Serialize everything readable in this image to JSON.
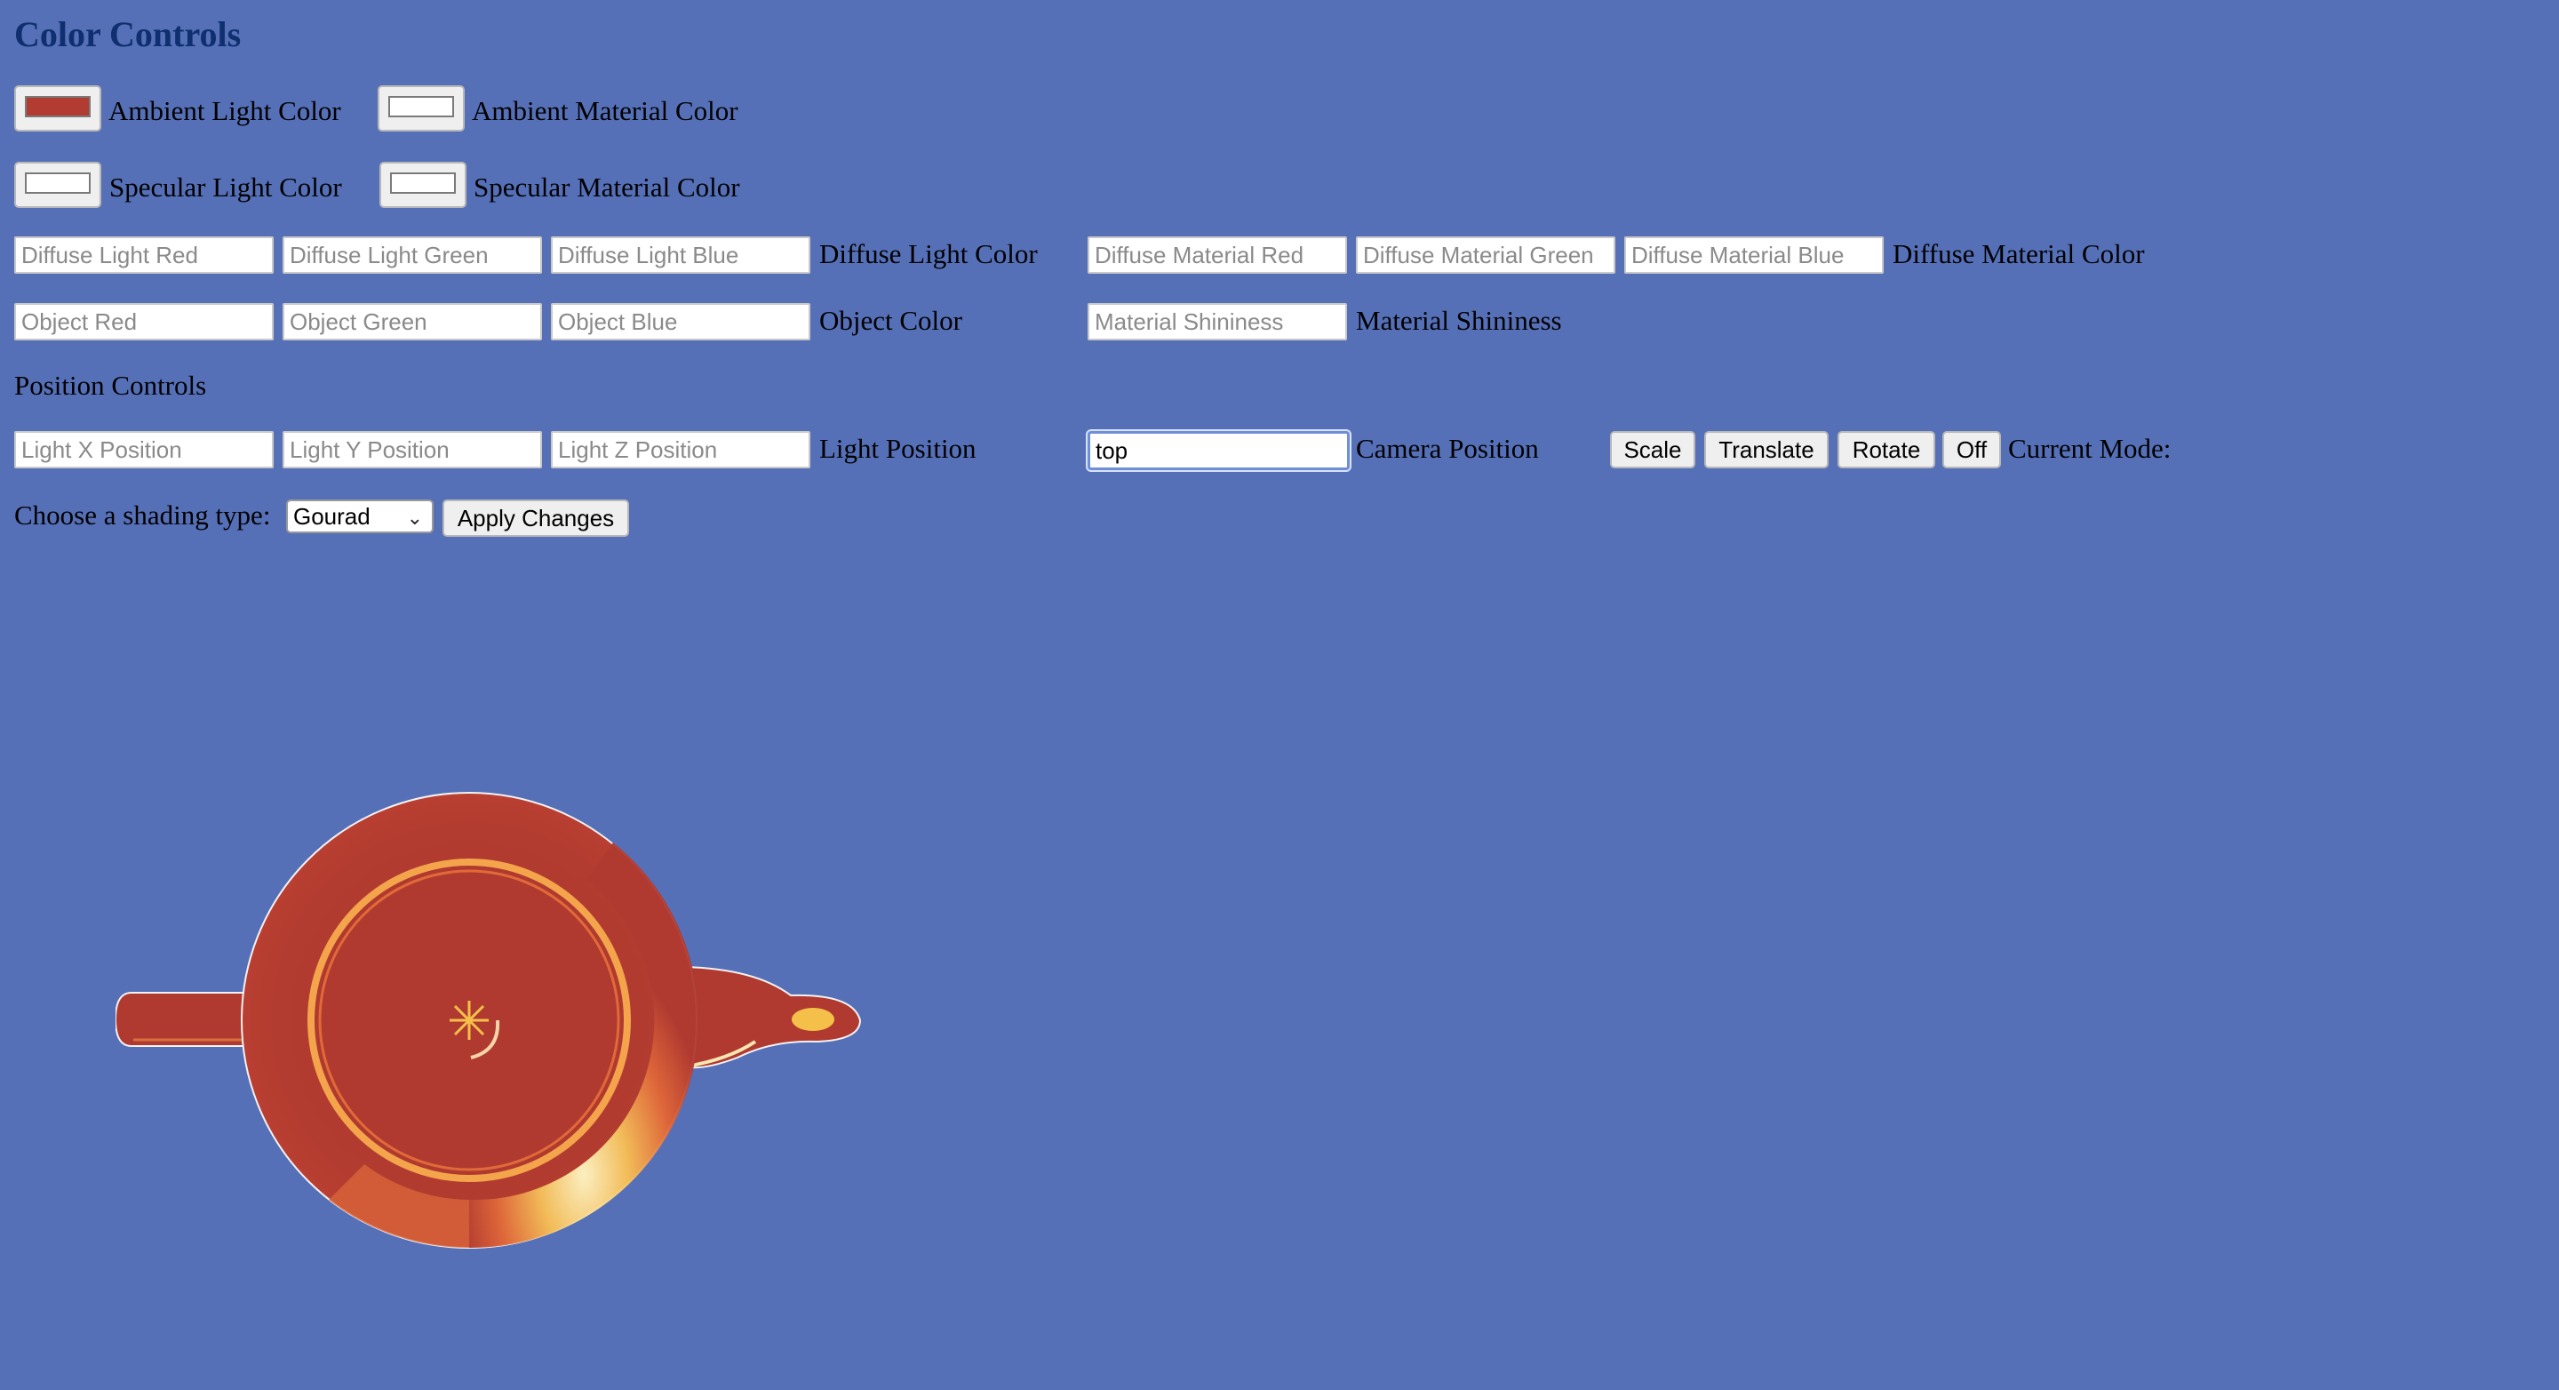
{
  "headings": {
    "color_controls": "Color Controls",
    "position_controls": "Position Controls"
  },
  "ambient": {
    "light_label": "Ambient Light Color",
    "material_label": "Ambient Material Color",
    "light_color": "#b23b32",
    "material_color": "#ffffff"
  },
  "specular": {
    "light_label": "Specular Light Color",
    "material_label": "Specular Material Color",
    "light_color": "#ffffff",
    "material_color": "#ffffff"
  },
  "diffuse_light": {
    "red_placeholder": "Diffuse Light Red",
    "green_placeholder": "Diffuse Light Green",
    "blue_placeholder": "Diffuse Light Blue",
    "label": "Diffuse Light Color"
  },
  "diffuse_material": {
    "red_placeholder": "Diffuse Material Red",
    "green_placeholder": "Diffuse Material Green",
    "blue_placeholder": "Diffuse Material Blue",
    "label": "Diffuse Material Color"
  },
  "object": {
    "red_placeholder": "Object Red",
    "green_placeholder": "Object Green",
    "blue_placeholder": "Object Blue",
    "label": "Object Color"
  },
  "shininess": {
    "placeholder": "Material Shininess",
    "label": "Material Shininess"
  },
  "light_position": {
    "x_placeholder": "Light X Position",
    "y_placeholder": "Light Y Position",
    "z_placeholder": "Light Z Position",
    "label": "Light Position"
  },
  "camera": {
    "value": "top",
    "label": "Camera Position"
  },
  "mode_buttons": {
    "scale": "Scale",
    "translate": "Translate",
    "rotate": "Rotate",
    "off": "Off",
    "current_mode_label": "Current Mode:"
  },
  "shading": {
    "label": "Choose a shading type:",
    "selected": "Gourad",
    "apply_label": "Apply Changes"
  },
  "canvas": {
    "background": "#5670b8",
    "teapot_color": "#b03a30"
  }
}
